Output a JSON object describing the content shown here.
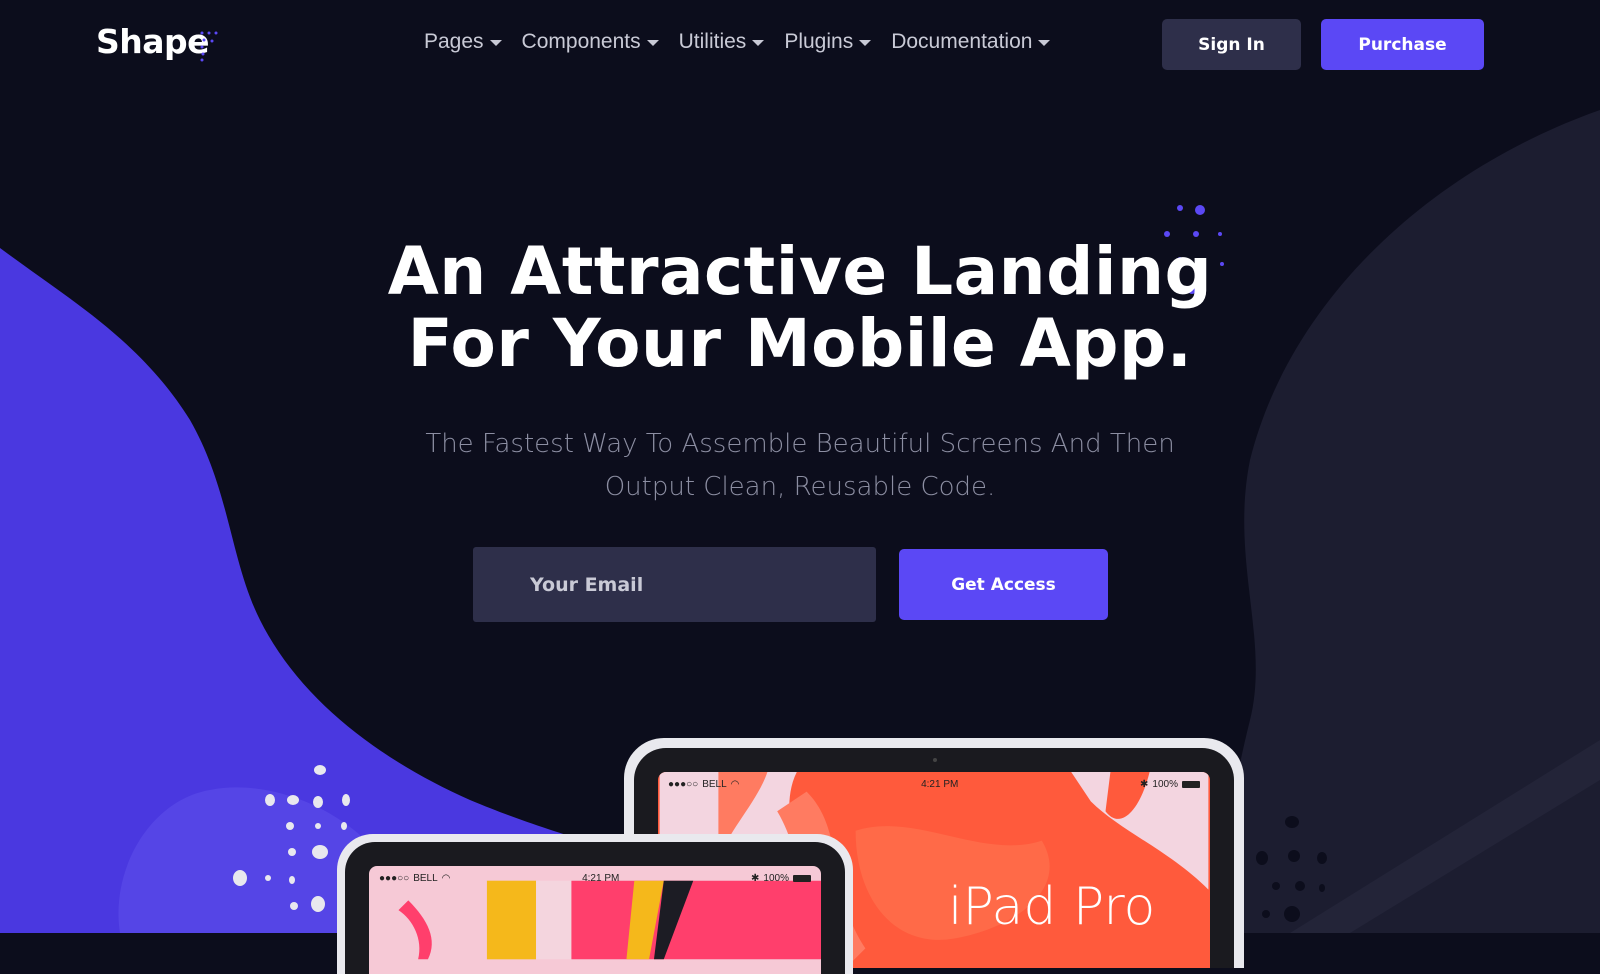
{
  "brand": {
    "name": "Shape"
  },
  "nav": {
    "items": [
      {
        "label": "Pages"
      },
      {
        "label": "Components"
      },
      {
        "label": "Utilities"
      },
      {
        "label": "Plugins"
      },
      {
        "label": "Documentation"
      }
    ],
    "signin_label": "Sign In",
    "purchase_label": "Purchase"
  },
  "hero": {
    "title_line1": "An Attractive Landing",
    "title_line2": "For Your Mobile App.",
    "subtitle_line1": "The Fastest Way To Assemble Beautiful Screens And Then",
    "subtitle_line2": "Output Clean, Reusable Code.",
    "email_placeholder": "Your Email",
    "email_value": "",
    "cta_label": "Get Access"
  },
  "devices": {
    "large": {
      "carrier": "BELL",
      "time": "4:21 PM",
      "battery": "100%",
      "label": "iPad Pro"
    },
    "small": {
      "carrier": "BELL",
      "time": "4:21 PM",
      "battery": "100%"
    }
  },
  "colors": {
    "background": "#0c0d1c",
    "accent": "#5b48f5",
    "blob": "#4a38e0",
    "secondary_button": "#2e2f4a",
    "right_shape": "#1c1d30"
  }
}
